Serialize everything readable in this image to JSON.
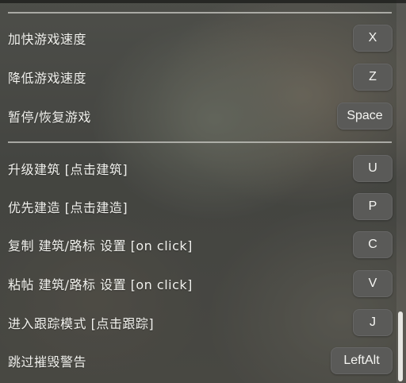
{
  "groups": [
    {
      "rows": [
        {
          "label": "加快游戏速度",
          "key": "X"
        },
        {
          "label": "降低游戏速度",
          "key": "Z"
        },
        {
          "label": "暂停/恢复游戏",
          "key": "Space"
        }
      ]
    },
    {
      "rows": [
        {
          "label": "升级建筑 [点击建筑]",
          "key": "U"
        },
        {
          "label": "优先建造 [点击建造]",
          "key": "P"
        },
        {
          "label": "复制 建筑/路标 设置 [on click]",
          "key": "C"
        },
        {
          "label": "粘帖 建筑/路标 设置 [on click]",
          "key": "V"
        },
        {
          "label": "进入跟踪模式 [点击跟踪]",
          "key": "J"
        },
        {
          "label": "跳过摧毁警告",
          "key": "LeftAlt"
        }
      ]
    }
  ]
}
